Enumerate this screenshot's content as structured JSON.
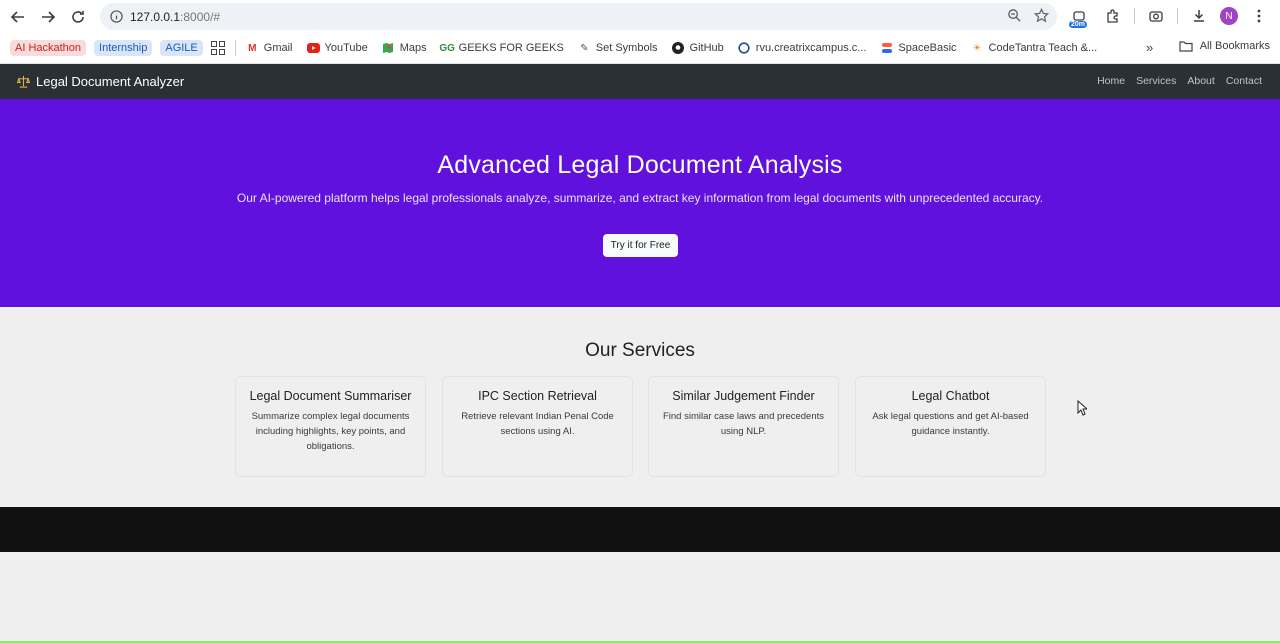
{
  "browser": {
    "url": "127.0.0.1:8000/#",
    "url_host": "127.0.0.1",
    "url_rest": ":8000/#",
    "ext_badge": "20m",
    "avatar_letter": "N"
  },
  "bookmarks": {
    "chips": [
      {
        "label": "AI Hackathon"
      },
      {
        "label": "Internship"
      },
      {
        "label": "AGILE"
      }
    ],
    "items": [
      {
        "label": "Gmail",
        "icon": "gmail-icon"
      },
      {
        "label": "YouTube",
        "icon": "youtube-icon"
      },
      {
        "label": "Maps",
        "icon": "maps-icon"
      },
      {
        "label": "GEEKS FOR GEEKS",
        "icon": "gfg-icon"
      },
      {
        "label": "Set Symbols",
        "icon": "set-symbols-icon"
      },
      {
        "label": "GitHub",
        "icon": "github-icon"
      },
      {
        "label": "rvu.creatrixcampus.c...",
        "icon": "creatrix-icon"
      },
      {
        "label": "SpaceBasic",
        "icon": "spacebasic-icon"
      },
      {
        "label": "CodeTantra Teach &...",
        "icon": "codetantra-icon"
      }
    ],
    "all_bookmarks": "All Bookmarks"
  },
  "site": {
    "brand": "Legal Document Analyzer",
    "nav": [
      "Home",
      "Services",
      "About",
      "Contact"
    ],
    "hero": {
      "title": "Advanced Legal Document Analysis",
      "subtitle": "Our AI-powered platform helps legal professionals analyze, summarize, and extract key information from legal documents with unprecedented accuracy.",
      "cta": "Try it for Free"
    },
    "services": {
      "heading": "Our Services",
      "cards": [
        {
          "title": "Legal Document Summariser",
          "desc": "Summarize complex legal documents including highlights, key points, and obligations."
        },
        {
          "title": "IPC Section Retrieval",
          "desc": "Retrieve relevant Indian Penal Code sections using AI."
        },
        {
          "title": "Similar Judgement Finder",
          "desc": "Find similar case laws and precedents using NLP."
        },
        {
          "title": "Legal Chatbot",
          "desc": "Ask legal questions and get AI-based guidance instantly."
        }
      ]
    }
  },
  "colors": {
    "hero_bg": "#6111dd",
    "navbar_bg": "#2b3035",
    "footer_bg": "#111111"
  }
}
